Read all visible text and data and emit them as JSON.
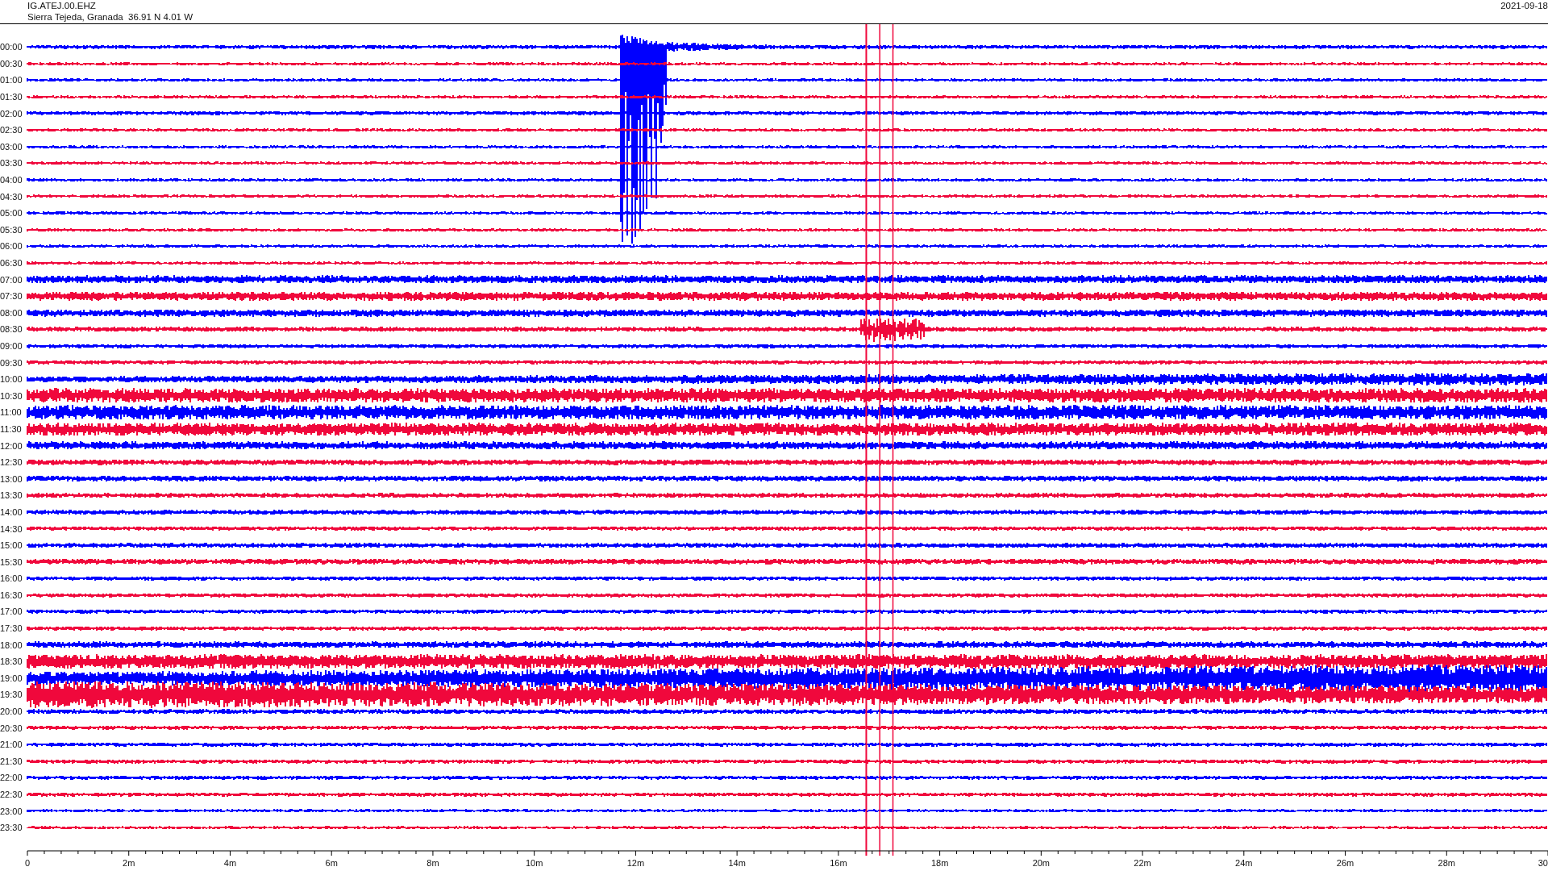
{
  "header": {
    "station": "IG.ATEJ.00.EHZ",
    "location": "Sierra Tejeda, Granada  36.91 N 4.01 W",
    "date": "2021-09-18"
  },
  "traces": [
    {
      "time": "00:00",
      "color": "#0000ff"
    },
    {
      "time": "00:30",
      "color": "#f0083c"
    },
    {
      "time": "01:00",
      "color": "#0000ff"
    },
    {
      "time": "01:30",
      "color": "#f0083c"
    },
    {
      "time": "02:00",
      "color": "#0000ff"
    },
    {
      "time": "02:30",
      "color": "#f0083c"
    },
    {
      "time": "03:00",
      "color": "#0000ff"
    },
    {
      "time": "03:30",
      "color": "#f0083c"
    },
    {
      "time": "04:00",
      "color": "#0000ff"
    },
    {
      "time": "04:30",
      "color": "#f0083c"
    },
    {
      "time": "05:00",
      "color": "#0000ff"
    },
    {
      "time": "05:30",
      "color": "#f0083c"
    },
    {
      "time": "06:00",
      "color": "#0000ff"
    },
    {
      "time": "06:30",
      "color": "#f0083c"
    },
    {
      "time": "07:00",
      "color": "#0000ff"
    },
    {
      "time": "07:30",
      "color": "#f0083c"
    },
    {
      "time": "08:00",
      "color": "#0000ff"
    },
    {
      "time": "08:30",
      "color": "#f0083c"
    },
    {
      "time": "09:00",
      "color": "#0000ff"
    },
    {
      "time": "09:30",
      "color": "#f0083c"
    },
    {
      "time": "10:00",
      "color": "#0000ff"
    },
    {
      "time": "10:30",
      "color": "#f0083c"
    },
    {
      "time": "11:00",
      "color": "#0000ff"
    },
    {
      "time": "11:30",
      "color": "#f0083c"
    },
    {
      "time": "12:00",
      "color": "#0000ff"
    },
    {
      "time": "12:30",
      "color": "#f0083c"
    },
    {
      "time": "13:00",
      "color": "#0000ff"
    },
    {
      "time": "13:30",
      "color": "#f0083c"
    },
    {
      "time": "14:00",
      "color": "#0000ff"
    },
    {
      "time": "14:30",
      "color": "#f0083c"
    },
    {
      "time": "15:00",
      "color": "#0000ff"
    },
    {
      "time": "15:30",
      "color": "#f0083c"
    },
    {
      "time": "16:00",
      "color": "#0000ff"
    },
    {
      "time": "16:30",
      "color": "#f0083c"
    },
    {
      "time": "17:00",
      "color": "#0000ff"
    },
    {
      "time": "17:30",
      "color": "#f0083c"
    },
    {
      "time": "18:00",
      "color": "#0000ff"
    },
    {
      "time": "18:30",
      "color": "#f0083c"
    },
    {
      "time": "19:00",
      "color": "#0000ff"
    },
    {
      "time": "19:30",
      "color": "#f0083c"
    },
    {
      "time": "20:00",
      "color": "#0000ff"
    },
    {
      "time": "20:30",
      "color": "#f0083c"
    },
    {
      "time": "21:00",
      "color": "#0000ff"
    },
    {
      "time": "21:30",
      "color": "#f0083c"
    },
    {
      "time": "22:00",
      "color": "#0000ff"
    },
    {
      "time": "22:30",
      "color": "#f0083c"
    },
    {
      "time": "23:00",
      "color": "#0000ff"
    },
    {
      "time": "23:30",
      "color": "#f0083c"
    }
  ],
  "x_axis": {
    "ticks": [
      "0",
      "2m",
      "4m",
      "6m",
      "8m",
      "10m",
      "12m",
      "14m",
      "16m",
      "18m",
      "20m",
      "22m",
      "24m",
      "26m",
      "28m",
      "30"
    ]
  }
}
